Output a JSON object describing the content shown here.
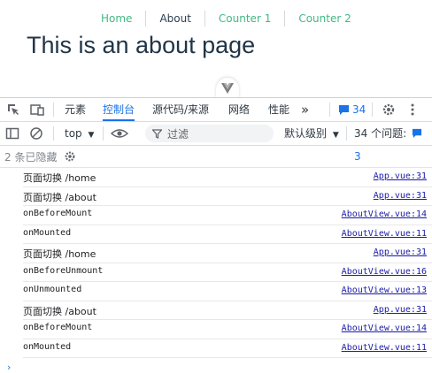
{
  "page": {
    "nav": [
      {
        "label": "Home"
      },
      {
        "label": "About"
      },
      {
        "label": "Counter 1"
      },
      {
        "label": "Counter 2"
      }
    ],
    "headline": "This is an about page"
  },
  "devtools": {
    "tabs": {
      "elements": "元素",
      "console": "控制台",
      "sources": "源代码/来源",
      "network": "网络",
      "performance": "性能",
      "more": "»"
    },
    "issues_count": "34",
    "toolbar": {
      "context": "top",
      "filter_placeholder": "过滤",
      "levels": "默认级别",
      "issues": "34 个问题:",
      "issues_tail": "3"
    },
    "hidden_text": "2 条已隐藏",
    "messages": [
      {
        "text": "页面切换 /home",
        "source": "App.vue:31"
      },
      {
        "text": "页面切换 /about",
        "source": "App.vue:31"
      },
      {
        "text": "onBeforeMount",
        "source": "AboutView.vue:14"
      },
      {
        "text": "onMounted",
        "source": "AboutView.vue:11"
      },
      {
        "text": "页面切换 /home",
        "source": "App.vue:31"
      },
      {
        "text": "onBeforeUnmount",
        "source": "AboutView.vue:16"
      },
      {
        "text": "onUnmounted",
        "source": "AboutView.vue:13"
      },
      {
        "text": "页面切换 /about",
        "source": "App.vue:31"
      },
      {
        "text": "onBeforeMount",
        "source": "AboutView.vue:14"
      },
      {
        "text": "onMounted",
        "source": "AboutView.vue:11"
      }
    ],
    "prompt": "›"
  },
  "colors": {
    "vue_green": "#42b883",
    "accent": "#1a73e8",
    "link": "#1a1aa6"
  }
}
